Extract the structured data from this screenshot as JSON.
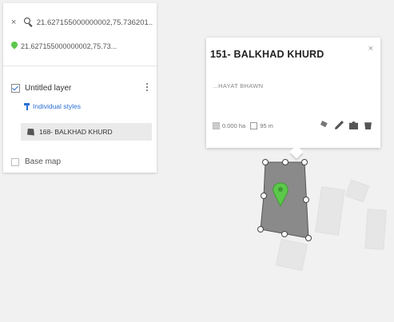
{
  "search": {
    "query": "21.627155000000002,75.736201...",
    "result": "21.627155000000002,75.73..."
  },
  "layer": {
    "name": "Untitled layer",
    "styles_label": "Individual styles",
    "feature_label": "168- BALKHAD KHURD"
  },
  "basemap": {
    "label": "Base map"
  },
  "popup": {
    "title": "151- BALKHAD KHURD",
    "subtitle": "...HAYAT BHAWN",
    "area": "0.000 ha",
    "perimeter": "95 m",
    "close": "×"
  },
  "colors": {
    "pin_green": "#5cc84a",
    "polygon_fill": "#8a8a8a",
    "link_blue": "#2b6fd6"
  },
  "icons": [
    "close-icon",
    "search-icon",
    "map-pin-icon",
    "checkbox-icon",
    "more-vert-icon",
    "paint-style-icon",
    "polygon-icon",
    "basemap-icon",
    "paint-bucket-icon",
    "edit-pencil-icon",
    "camera-icon",
    "trash-icon"
  ]
}
